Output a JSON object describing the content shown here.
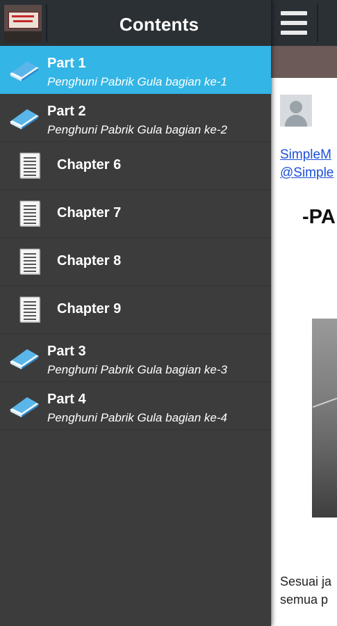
{
  "header": {
    "title": "Contents"
  },
  "toc": [
    {
      "label": "Part 1",
      "subtitle": "Penghuni Pabrik Gula bagian ke-1",
      "icon": "book-icon",
      "selected": true
    },
    {
      "label": "Part 2",
      "subtitle": "Penghuni Pabrik Gula bagian ke-2",
      "icon": "book-icon",
      "selected": false
    },
    {
      "label": "Chapter 6",
      "icon": "document-icon"
    },
    {
      "label": "Chapter 7",
      "icon": "document-icon"
    },
    {
      "label": "Chapter 8",
      "icon": "document-icon"
    },
    {
      "label": "Chapter 9",
      "icon": "document-icon"
    },
    {
      "label": "Part 3",
      "subtitle": "Penghuni Pabrik Gula bagian ke-3",
      "icon": "book-icon",
      "selected": false
    },
    {
      "label": "Part 4",
      "subtitle": "Penghuni Pabrik Gula bagian ke-4",
      "icon": "book-icon",
      "selected": false
    }
  ],
  "reader": {
    "link_line1": "SimpleM",
    "link_line2": "@Simple",
    "heading": "-PA",
    "body_line1": "Sesuai ja",
    "body_line2": "semua p"
  },
  "colors": {
    "selected": "#33b5e5",
    "drawer_bg": "#3c3c3c",
    "header_bg": "#2b3035",
    "link": "#1a4fd6"
  }
}
